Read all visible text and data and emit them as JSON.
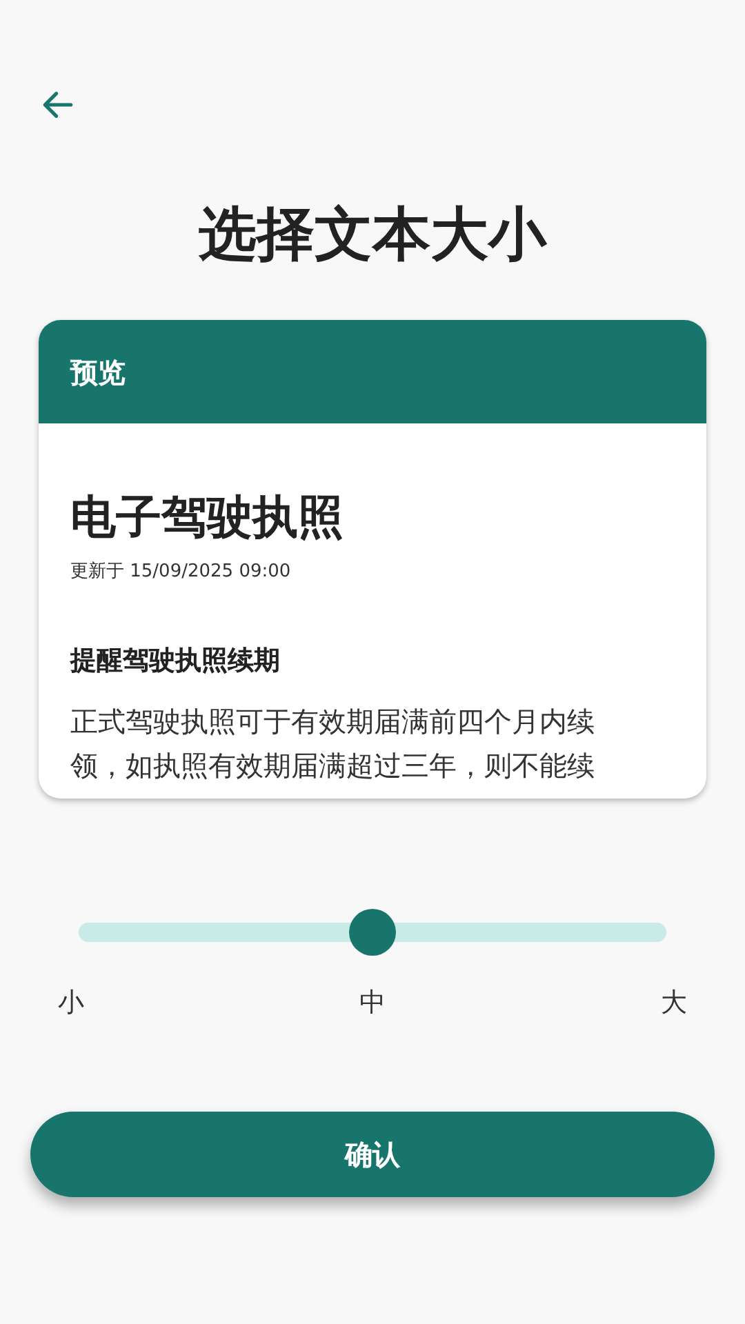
{
  "title": "选择文本大小",
  "preview": {
    "header": "预览",
    "heading": "电子驾驶执照",
    "updated": "更新于 15/09/2025 09:00",
    "subheading": "提醒驾驶执照续期",
    "body": [
      "正式驾驶执照可于有效期届满前四个月内续",
      "领，如执照有效期届满超过三年，则不能续"
    ]
  },
  "size_slider": {
    "level": 0.5,
    "labels": [
      "小",
      "中",
      "大"
    ]
  },
  "confirm_button": "确认"
}
